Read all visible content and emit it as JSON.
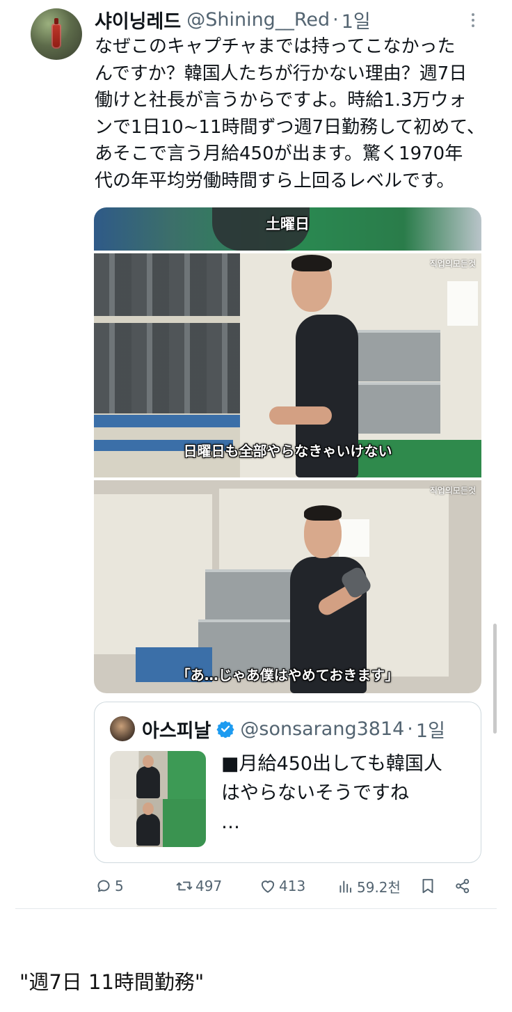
{
  "tweet": {
    "author_name": "샤이닝레드",
    "author_handle": "@Shining__Red",
    "separator": "·",
    "time": "1일",
    "text": "なぜこのキャプチャまでは持ってこなかった\nんですか？韓国人たちが行かない理由？週7日\n働けと社長が言うからですよ。時給1.3万ウォ\nンで1日10~11時間ずつ週7日勤務して初めて、\nあそこで言う月給450が出ます。驚く1970年\n代の年平均労働時間すら上回るレベルです。"
  },
  "media": {
    "top_caption": "土曜日",
    "watermark": "직업의모든것",
    "subtitle_1": "日曜日も全部やらなきゃいけない",
    "subtitle_2": "「あ…じゃあ僕はやめておきます」"
  },
  "quote": {
    "author_name": "아스피날",
    "author_handle": "@sonsarang3814",
    "separator": "·",
    "time": "1일",
    "text": "■月給450出しても韓国人\nはやらないそうですね\n…",
    "verified_color": "#1d9bf0"
  },
  "actions": {
    "replies": "5",
    "retweets": "497",
    "likes": "413",
    "views": "59.2천"
  },
  "caption": "\"週7日 11時間勤務\""
}
